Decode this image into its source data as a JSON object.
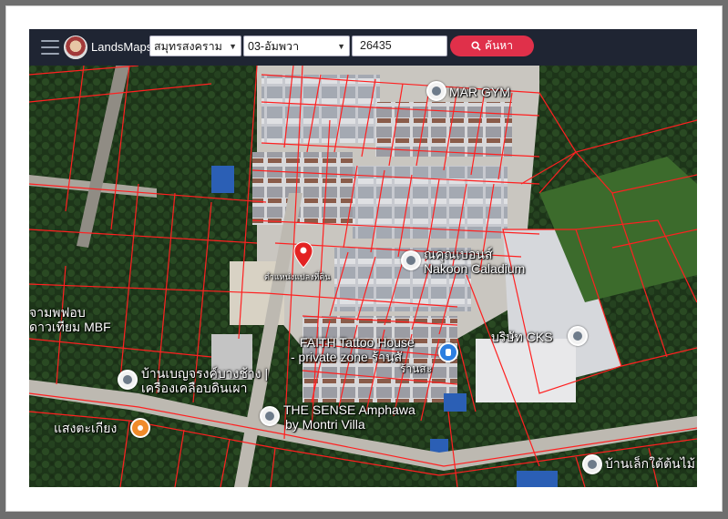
{
  "app": {
    "name": "LandsMaps"
  },
  "search": {
    "province": "สมุทรสงคราม",
    "district": "03-อัมพวา",
    "parcel_number": "26435",
    "button_label": "ค้นหา"
  },
  "map": {
    "poi": [
      {
        "label": "MAR GYM"
      },
      {
        "label": "ณคุณเบอนส์"
      },
      {
        "label": "Nakoon Caladium"
      },
      {
        "label": "FAITH Tattoo House"
      },
      {
        "label": "- private zone ร้านสั"
      },
      {
        "label": "บริษัท CKS"
      },
      {
        "label": "บ้านเบญจรงค์บางช้าง |"
      },
      {
        "label": "เครื่องเคลือบดินเผา"
      },
      {
        "label": "THE SENSE Amphawa"
      },
      {
        "label": "by Montri Villa"
      },
      {
        "label": "แสงตะเกียง"
      },
      {
        "label": "บ้านเล็กใต้ต้นไม้"
      },
      {
        "label": "จามพฟอบ"
      },
      {
        "label": "ดาวเทียม MBF"
      }
    ],
    "pin_label": "ตำแหน่งแปลงที่ดิน",
    "store_label": "ร้านสะ"
  },
  "colors": {
    "topbar": "#1f2533",
    "search_button": "#e0304a",
    "parcel_line": "#ff2020"
  }
}
